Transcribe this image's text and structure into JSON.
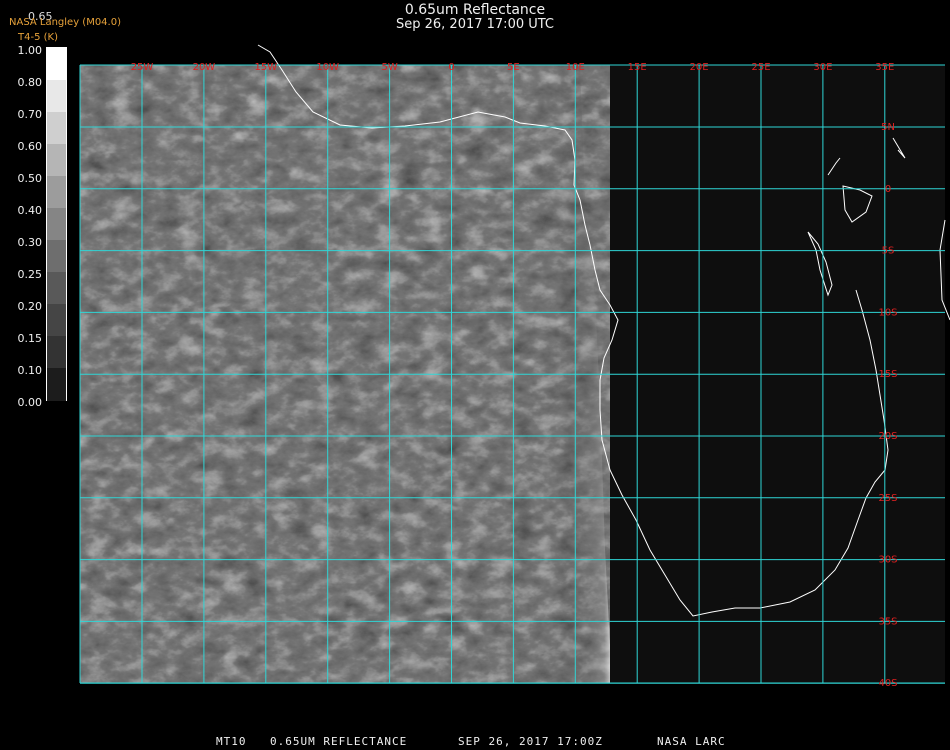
{
  "header": {
    "title": "0.65um Reflectance",
    "datetime": "Sep 26, 2017 17:00 UTC",
    "organization": "NASA Langley (M04.0)",
    "band_label": "0.65",
    "channel_label": "T4-5 (K)"
  },
  "colorbar": {
    "labels": [
      "1.00",
      "0.80",
      "0.70",
      "0.60",
      "0.50",
      "0.40",
      "0.30",
      "0.25",
      "0.20",
      "0.15",
      "0.10",
      "0.00"
    ],
    "colors": [
      "#ffffff",
      "#e8e8e8",
      "#cfcfcf",
      "#b5b5b5",
      "#9c9c9c",
      "#858585",
      "#6e6e6e",
      "#595959",
      "#454545",
      "#333333",
      "#1c1c1c"
    ]
  },
  "grid": {
    "lon_labels": [
      "25W",
      "20W",
      "15W",
      "10W",
      "5W",
      "0",
      "5E",
      "10E",
      "15E",
      "20E",
      "25E",
      "30E",
      "35E"
    ],
    "lat_labels": [
      "5N",
      "0",
      "5S",
      "10S",
      "15S",
      "20S",
      "25S",
      "30S",
      "35S",
      "40S"
    ],
    "grid_color": "#2fd6d6",
    "label_color": "#e02020"
  },
  "footer": {
    "satellite": "MT10",
    "product": "0.65UM REFLECTANCE",
    "date": "SEP 26, 2017 17:00Z",
    "source": "NASA LARC"
  }
}
